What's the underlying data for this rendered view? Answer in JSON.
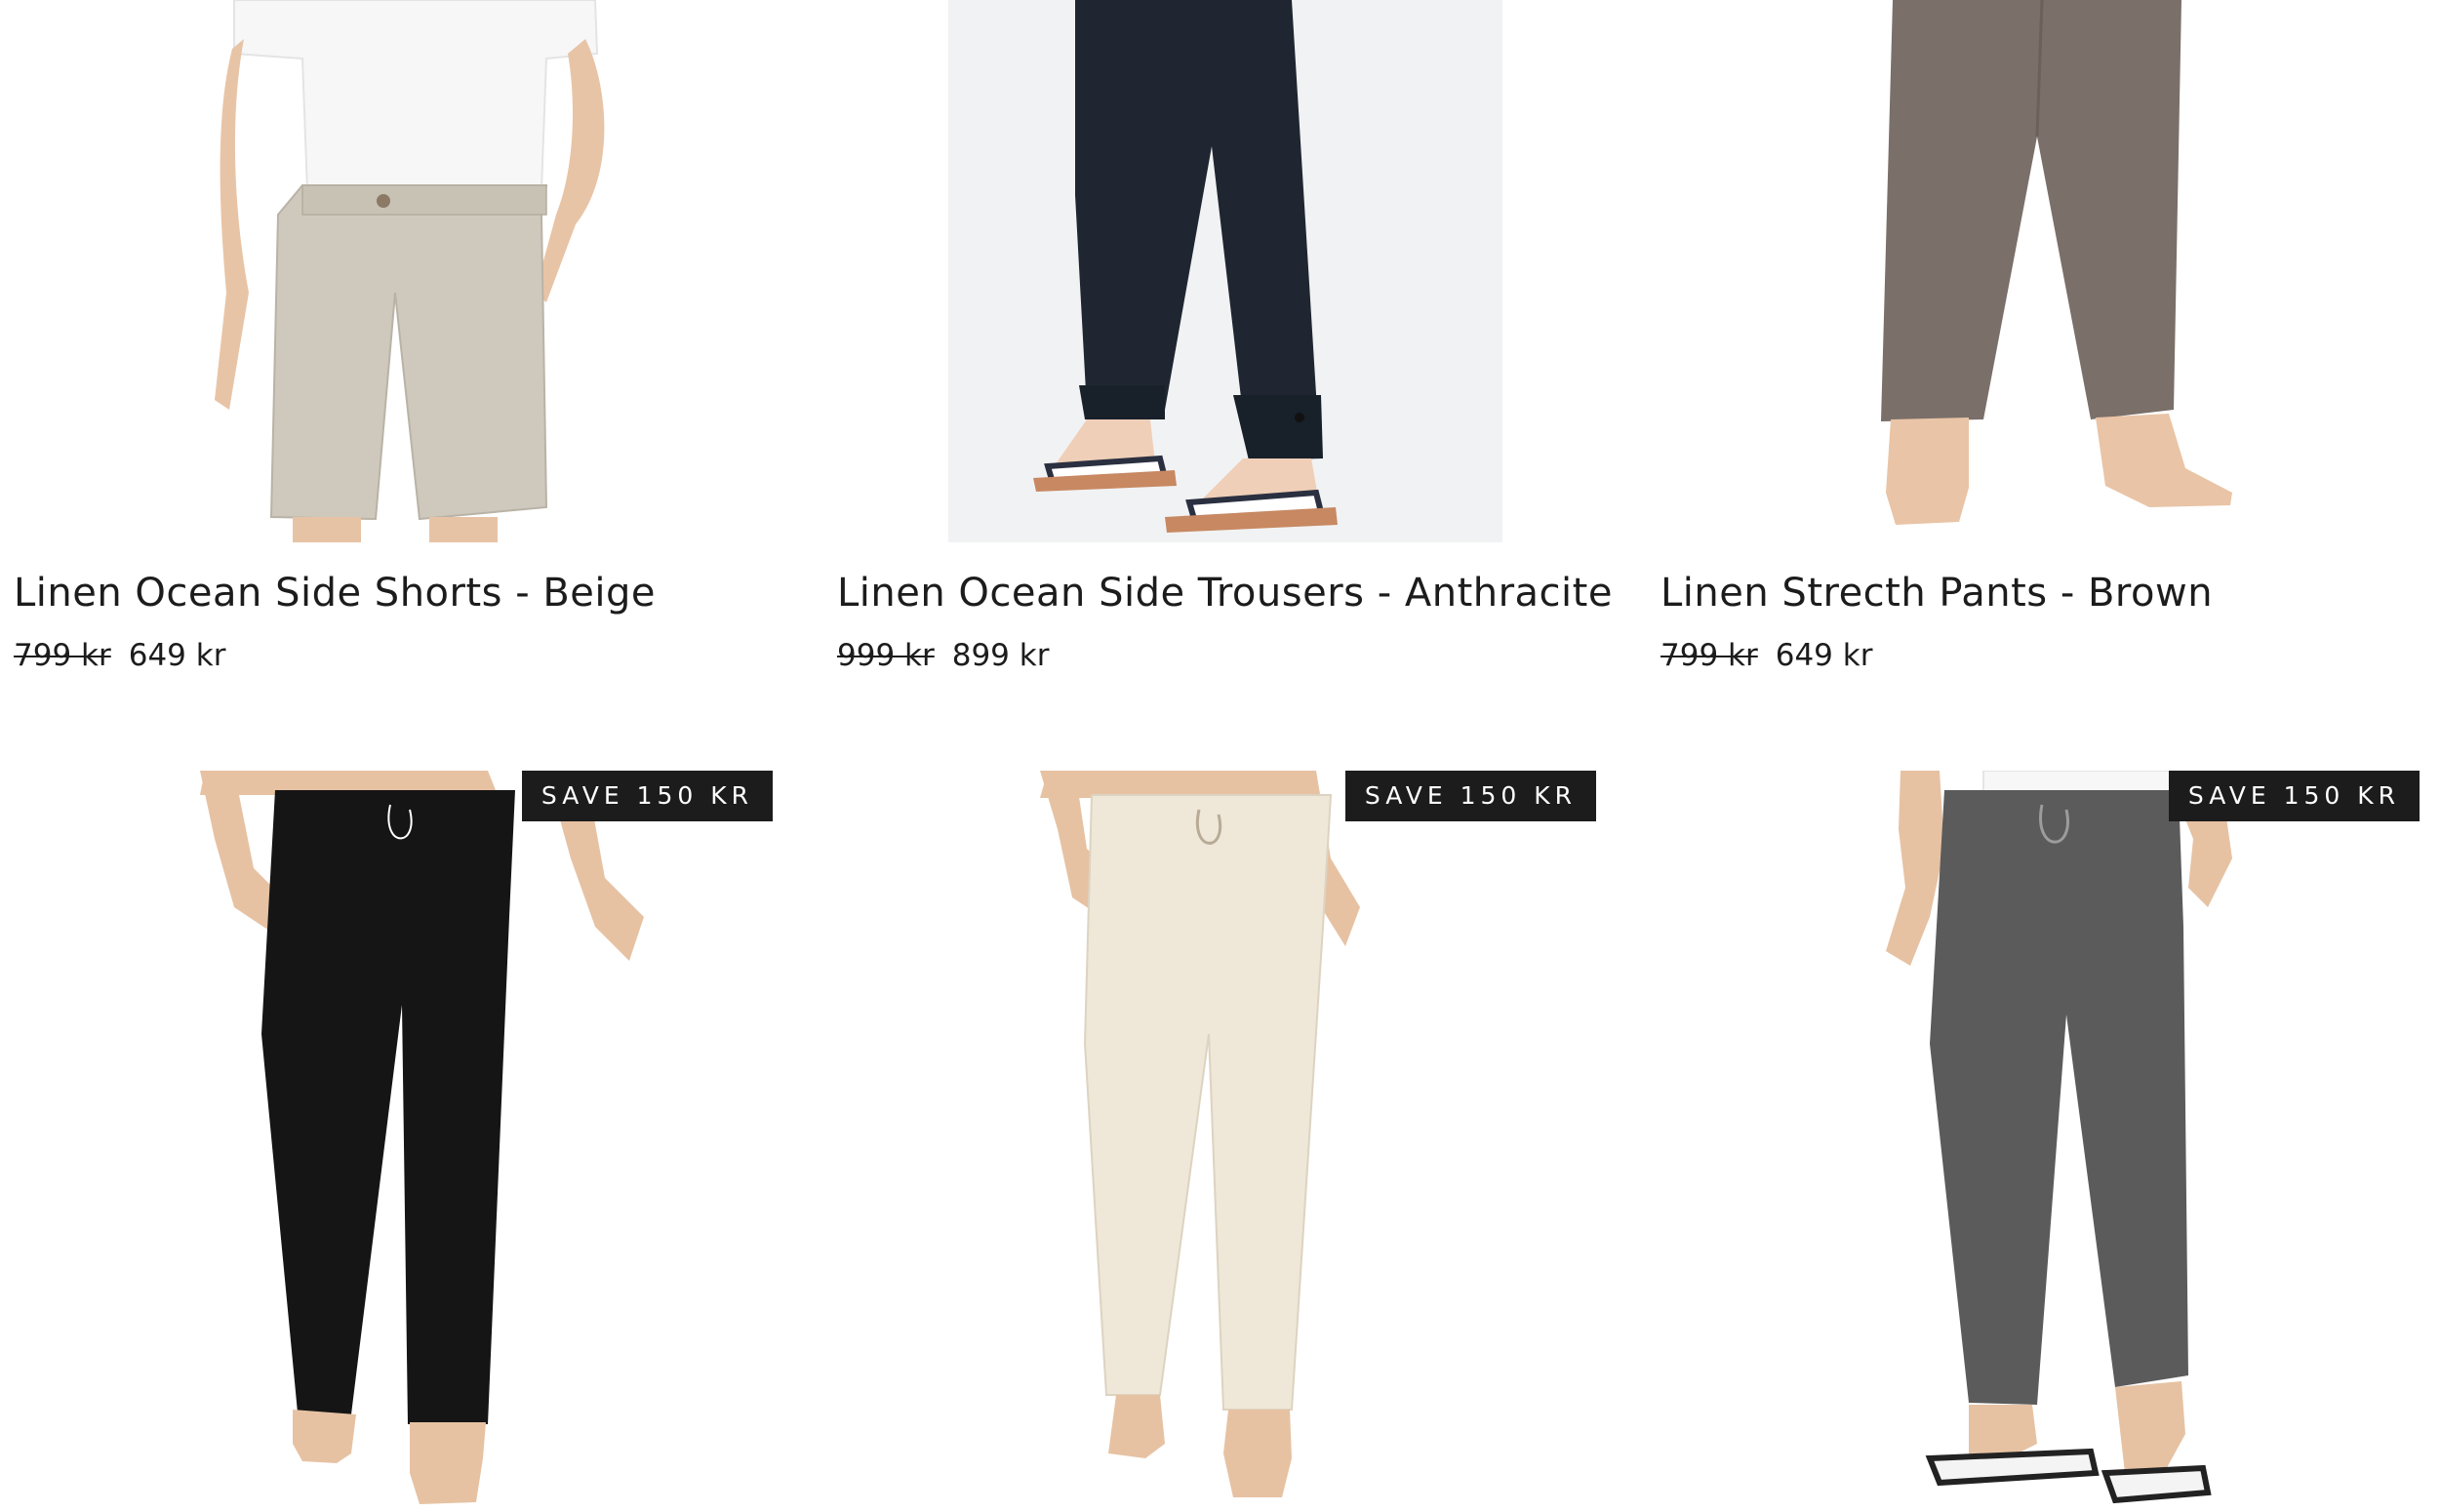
{
  "products": [
    {
      "title": "Linen Ocean Side Shorts - Beige",
      "price_old": "799 kr",
      "price_new": "649 kr",
      "image": "beige-linen-shorts-photo",
      "color": "#cfc9bd"
    },
    {
      "title": "Linen Ocean Side Trousers - Anthracite",
      "price_old": "999 kr",
      "price_new": "899 kr",
      "image": "anthracite-linen-trousers-photo",
      "color": "#1f2631"
    },
    {
      "title": "Linen Strecth Pants - Brown",
      "price_old": "799 kr",
      "price_new": "649 kr",
      "image": "brown-linen-pants-photo",
      "color": "#7a6f69"
    },
    {
      "badge": "SAVE 150 KR",
      "image": "black-linen-pants-photo",
      "color": "#151515"
    },
    {
      "badge": "SAVE 150 KR",
      "image": "cream-linen-pants-photo",
      "color": "#efe7d8"
    },
    {
      "badge": "SAVE 150 KR",
      "image": "grey-linen-pants-photo",
      "color": "#5b5b5b"
    }
  ],
  "colors": {
    "text": "#1c1c1c",
    "badge_bg": "#1c1c1c",
    "badge_text": "#ffffff",
    "background": "#ffffff"
  }
}
